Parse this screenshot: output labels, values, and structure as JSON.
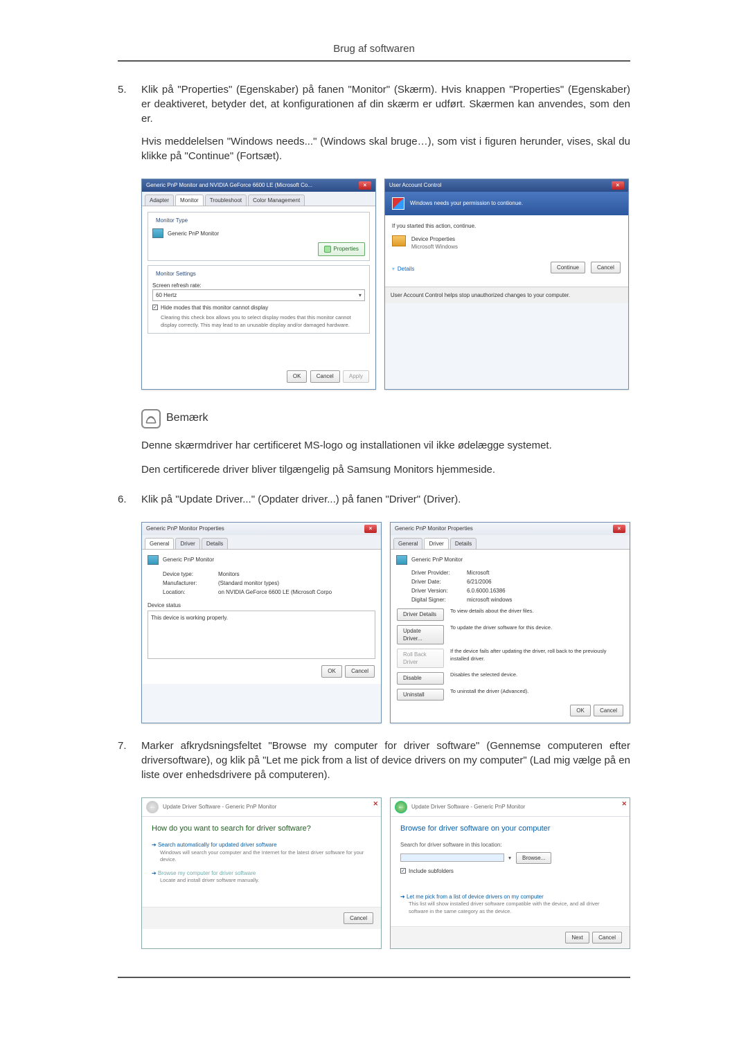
{
  "page_header": "Brug af softwaren",
  "step5_num": "5.",
  "step5_p1": "Klik på \"Properties\" (Egenskaber) på fanen \"Monitor\" (Skærm). Hvis knappen \"Properties\" (Egenskaber) er deaktiveret, betyder det, at konfigurationen af din skærm er udført. Skærmen kan anvendes, som den er.",
  "step5_p2": "Hvis meddelelsen \"Windows needs...\" (Windows skal bruge…), som vist i figuren herunder, vises, skal du klikke på \"Continue\" (Fortsæt).",
  "monitor_dialog": {
    "title": "Generic PnP Monitor and NVIDIA GeForce 6600 LE (Microsoft Co...",
    "tabs": [
      "Adapter",
      "Monitor",
      "Troubleshoot",
      "Color Management"
    ],
    "type_header": "Monitor Type",
    "type_name": "Generic PnP Monitor",
    "properties_btn": "Properties",
    "settings_header": "Monitor Settings",
    "refresh_label": "Screen refresh rate:",
    "refresh_value": "60 Hertz",
    "hide_checkbox": "Hide modes that this monitor cannot display",
    "hide_help": "Clearing this check box allows you to select display modes that this monitor cannot display correctly. This may lead to an unusable display and/or damaged hardware.",
    "ok": "OK",
    "cancel": "Cancel",
    "apply": "Apply"
  },
  "uac": {
    "title": "User Account Control",
    "banner": "Windows needs your permission to contionue.",
    "if_started": "If you started this action, continue.",
    "dev_props": "Device Properties",
    "ms_win": "Microsoft Windows",
    "details": "Details",
    "continue_btn": "Continue",
    "cancel_btn": "Cancel",
    "footer": "User Account Control helps stop unauthorized changes to your computer."
  },
  "note_label": "Bemærk",
  "note_p1": "Denne skærmdriver har certificeret MS-logo og installationen vil ikke ødelægge systemet.",
  "note_p2": "Den certificerede driver bliver tilgængelig på Samsung Monitors hjemmeside.",
  "step6_num": "6.",
  "step6_p": "Klik på \"Update Driver...\" (Opdater driver...) på fanen \"Driver\" (Driver).",
  "props_general": {
    "title": "Generic PnP Monitor Properties",
    "tabs": [
      "General",
      "Driver",
      "Details"
    ],
    "name": "Generic PnP Monitor",
    "k_type": "Device type:",
    "v_type": "Monitors",
    "k_man": "Manufacturer:",
    "v_man": "(Standard monitor types)",
    "k_loc": "Location:",
    "v_loc": "on NVIDIA GeForce 6600 LE (Microsoft Corpo",
    "status_h": "Device status",
    "status": "This device is working properly.",
    "ok": "OK",
    "cancel": "Cancel"
  },
  "props_driver": {
    "title": "Generic PnP Monitor Properties",
    "tabs": [
      "General",
      "Driver",
      "Details"
    ],
    "name": "Generic PnP Monitor",
    "k_prov": "Driver Provider:",
    "v_prov": "Microsoft",
    "k_date": "Driver Date:",
    "v_date": "6/21/2006",
    "k_ver": "Driver Version:",
    "v_ver": "6.0.6000.16386",
    "k_sign": "Digital Signer:",
    "v_sign": "microsoft windows",
    "b_details": "Driver Details",
    "d_details": "To view details about the driver files.",
    "b_update": "Update Driver...",
    "d_update": "To update the driver software for this device.",
    "b_roll": "Roll Back Driver",
    "d_roll": "If the device fails after updating the driver, roll back to the previously installed driver.",
    "b_disable": "Disable",
    "d_disable": "Disables the selected device.",
    "b_uninstall": "Uninstall",
    "d_uninstall": "To uninstall the driver (Advanced).",
    "ok": "OK",
    "cancel": "Cancel"
  },
  "step7_num": "7.",
  "step7_p": "Marker afkrydsningsfeltet \"Browse my computer for driver software\" (Gennemse computeren efter driversoftware), og klik på \"Let me pick from a list of device drivers on my computer\" (Lad mig vælge på en liste over enhedsdrivere på computeren).",
  "wizard_a": {
    "breadcrumb": "Update Driver Software - Generic PnP Monitor",
    "h": "How do you want to search for driver software?",
    "opt1": "Search automatically for updated driver software",
    "opt1_sub": "Windows will search your computer and the Internet for the latest driver software for your device.",
    "opt2": "Browse my computer for driver software",
    "opt2_sub": "Locate and install driver software manually.",
    "cancel": "Cancel"
  },
  "wizard_b": {
    "breadcrumb": "Update Driver Software - Generic PnP Monitor",
    "h": "Browse for driver software on your computer",
    "loc_label": "Search for driver software in this location:",
    "browse": "Browse...",
    "include": "Include subfolders",
    "opt": "Let me pick from a list of device drivers on my computer",
    "opt_sub": "This list will show installed driver software compatible with the device, and all driver software in the same category as the device.",
    "next": "Next",
    "cancel": "Cancel"
  }
}
